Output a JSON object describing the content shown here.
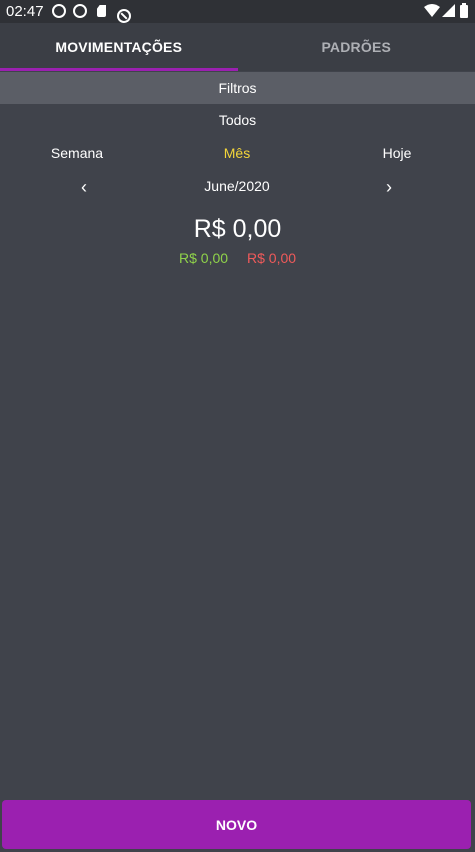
{
  "status_bar": {
    "time": "02:47",
    "icons": [
      "circle-notification-icon",
      "circle-notification-icon",
      "sd-card-icon",
      "sync-disabled-icon",
      "wifi-icon",
      "signal-icon",
      "battery-icon"
    ]
  },
  "tabs": [
    {
      "label": "MOVIMENTAÇÕES",
      "active": true
    },
    {
      "label": "PADRÕES",
      "active": false
    }
  ],
  "filters": {
    "label": "Filtros",
    "type_selected": "Todos"
  },
  "periods": {
    "options": [
      "Semana",
      "Mês",
      "Hoje"
    ],
    "selected": "Mês"
  },
  "month_nav": {
    "prev_icon": "chevron-left-icon",
    "next_icon": "chevron-right-icon",
    "current": "June/2020"
  },
  "summary": {
    "total": "R$ 0,00",
    "income": "R$ 0,00",
    "expense": "R$ 0,00"
  },
  "actions": {
    "new_label": "NOVO"
  },
  "colors": {
    "accent": "#9b20b0",
    "background": "#40434b",
    "selected_period": "#f4d63a",
    "income": "#8fd24a",
    "expense": "#ef5a5a"
  }
}
